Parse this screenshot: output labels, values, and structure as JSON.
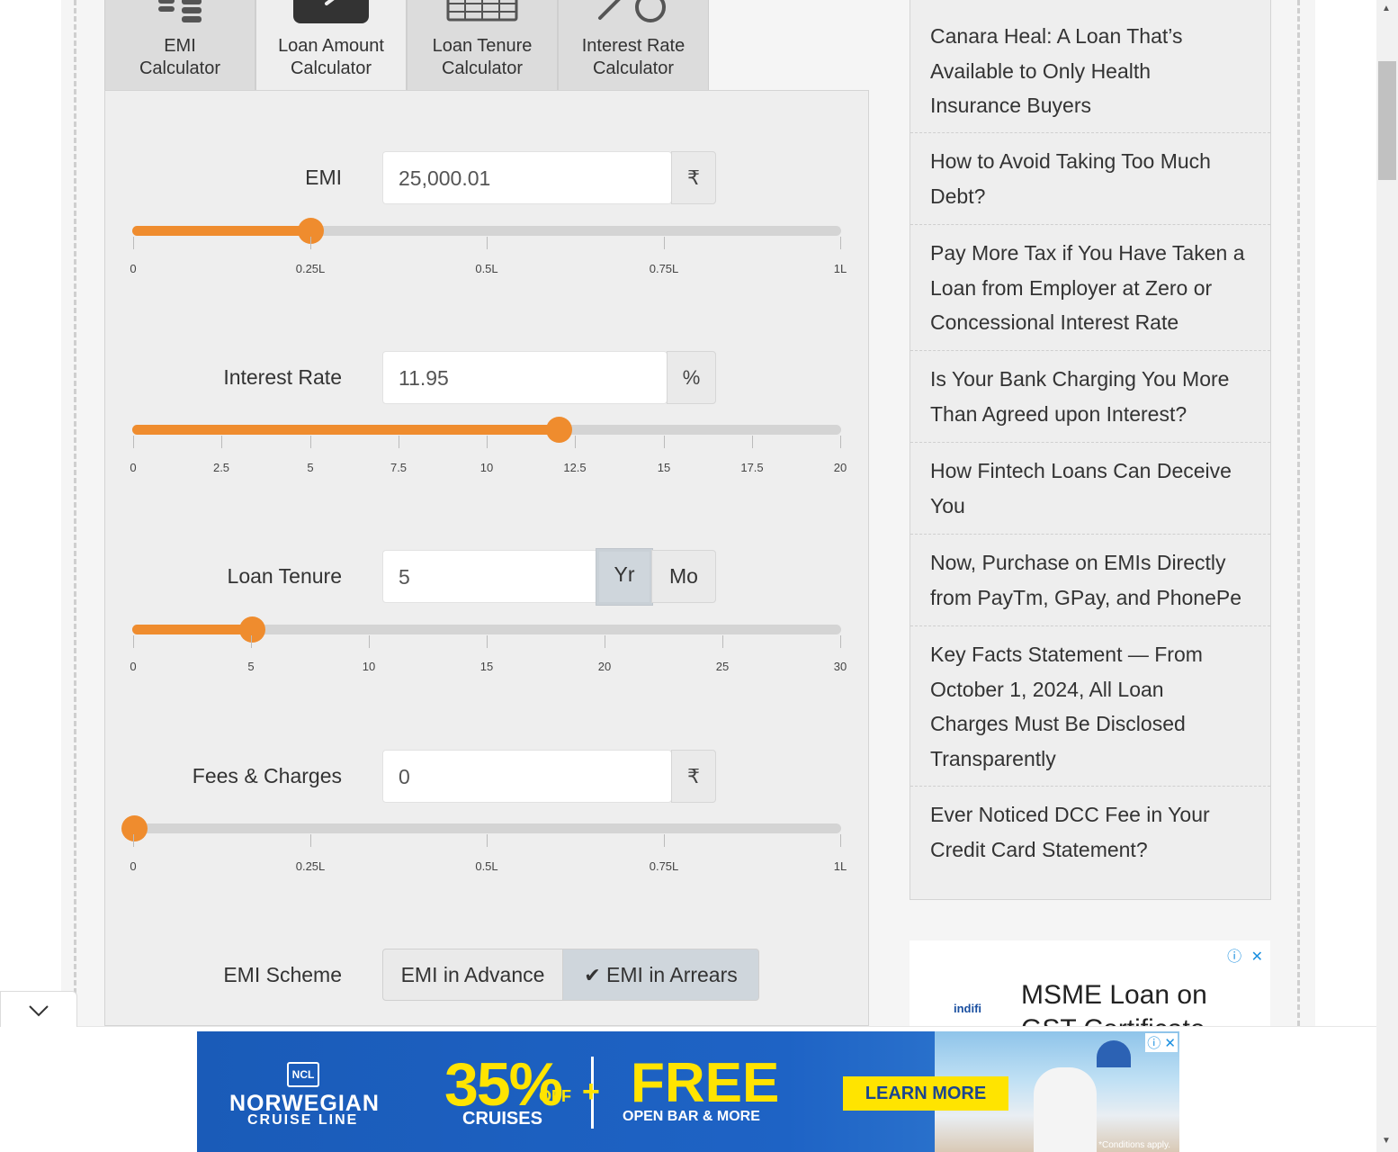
{
  "tabs": [
    {
      "label_line1": "EMI",
      "label_line2": "Calculator",
      "icon": "coins-icon",
      "active": false
    },
    {
      "label_line1": "Loan Amount",
      "label_line2": "Calculator",
      "icon": "calculator-icon",
      "active": true
    },
    {
      "label_line1": "Loan Tenure",
      "label_line2": "Calculator",
      "icon": "calendar-icon",
      "active": false
    },
    {
      "label_line1": "Interest Rate",
      "label_line2": "Calculator",
      "icon": "percent-icon",
      "active": false
    }
  ],
  "emi": {
    "label": "EMI",
    "value": "25,000.01",
    "unit": "₹",
    "slider": {
      "min": 0,
      "max": 100000,
      "value": 25000.01,
      "ticks": [
        "0",
        "0.25L",
        "0.5L",
        "0.75L",
        "1L"
      ]
    }
  },
  "interest": {
    "label": "Interest Rate",
    "value": "11.95",
    "unit": "%",
    "slider": {
      "min": 0,
      "max": 20,
      "value": 12.05,
      "ticks": [
        "0",
        "2.5",
        "5",
        "7.5",
        "10",
        "12.5",
        "15",
        "17.5",
        "20"
      ]
    }
  },
  "tenure": {
    "label": "Loan Tenure",
    "value": "5",
    "unit_year": "Yr",
    "unit_month": "Mo",
    "slider": {
      "min": 0,
      "max": 30,
      "value": 5,
      "ticks": [
        "0",
        "5",
        "10",
        "15",
        "20",
        "25",
        "30"
      ]
    }
  },
  "fees": {
    "label": "Fees & Charges",
    "value": "0",
    "unit": "₹",
    "slider": {
      "min": 0,
      "max": 100000,
      "value": 0,
      "ticks": [
        "0",
        "0.25L",
        "0.5L",
        "0.75L",
        "1L"
      ]
    }
  },
  "scheme": {
    "label": "EMI Scheme",
    "advance": "EMI in Advance",
    "arrears": "EMI in Arrears",
    "check": "✔"
  },
  "sidebar": {
    "items": [
      {
        "lines": [
          "Canara Heal: A Loan That’s",
          "Available to Only Health",
          "Insurance Buyers"
        ]
      },
      {
        "lines": [
          "How to Avoid Taking Too Much",
          "Debt?"
        ]
      },
      {
        "lines": [
          "Pay More Tax if You Have Taken a",
          "Loan from Employer at Zero or",
          "Concessional Interest Rate"
        ]
      },
      {
        "lines": [
          "Is Your Bank Charging You More",
          "Than Agreed upon Interest?"
        ]
      },
      {
        "lines": [
          "How Fintech Loans Can Deceive",
          "You"
        ]
      },
      {
        "lines": [
          "Now, Purchase on EMIs Directly",
          "from PayTm, GPay, and PhonePe"
        ]
      },
      {
        "lines": [
          "Key Facts Statement — From",
          "October 1, 2024, All Loan",
          "Charges Must Be Disclosed",
          "Transparently"
        ]
      },
      {
        "lines": [
          "Ever Noticed DCC Fee in Your",
          "Credit Card Statement?"
        ]
      }
    ]
  },
  "side_ad": {
    "brand": "indifi",
    "headline": "MSME Loan on",
    "headline2": "GST Certificate",
    "info_icon": "ⓘ",
    "close_icon": "✕"
  },
  "banner": {
    "logo": "NCL",
    "brand": "NORWEGIAN",
    "brand_sub": "CRUISE LINE",
    "pct": "35%",
    "off": "OFF",
    "cruises": "CRUISES",
    "plus": "+",
    "free": "FREE",
    "openbar": "OPEN BAR & MORE",
    "cta": "LEARN MORE",
    "conditions": "*Conditions apply.",
    "adctl": "ⓘ ✕"
  },
  "collapse_icon": "chevron-down-icon",
  "scroll": {
    "up": "▲",
    "down": "▼"
  },
  "colors": {
    "accent": "#ef8c2e",
    "track": "#d4d4d4",
    "panel": "#eeeeee"
  }
}
